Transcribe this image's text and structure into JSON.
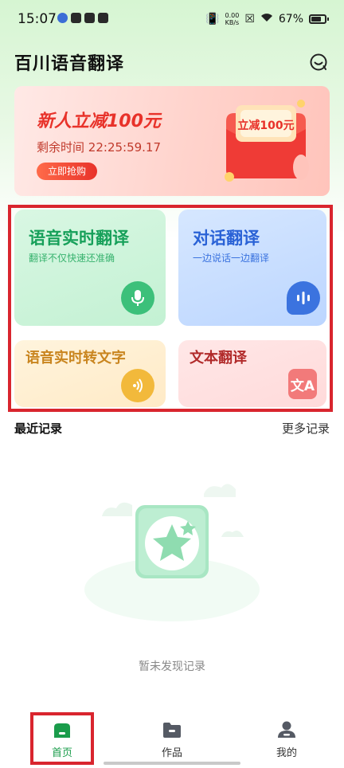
{
  "status_bar": {
    "time": "15:07",
    "net_speed_value": "0.00",
    "net_speed_unit": "KB/s",
    "battery": "67%"
  },
  "app": {
    "title": "百川语音翻译"
  },
  "promo": {
    "headline": "新人立减100元",
    "remaining_label": "剩余时间",
    "remaining_time": "22:25:59.17",
    "button": "立即抢购",
    "envelope_text": "立减100元"
  },
  "features": [
    {
      "title": "语音实时翻译",
      "subtitle": "翻译不仅快速还准确",
      "icon": "microphone-icon"
    },
    {
      "title": "对话翻译",
      "subtitle": "一边说话一边翻译",
      "icon": "voice-wave-icon"
    },
    {
      "title": "语音实时转文字",
      "icon": "sound-waves-icon"
    },
    {
      "title": "文本翻译",
      "icon": "translate-icon"
    }
  ],
  "recent": {
    "title": "最近记录",
    "more": "更多记录",
    "empty_text": "暂未发现记录"
  },
  "nav": [
    {
      "label": "首页",
      "icon": "home-icon",
      "active": true
    },
    {
      "label": "作品",
      "icon": "folder-icon",
      "active": false
    },
    {
      "label": "我的",
      "icon": "user-icon",
      "active": false
    }
  ],
  "colors": {
    "primary_green": "#1a9c4b",
    "promo_red": "#e8322a",
    "highlight_red": "#d9252e"
  }
}
